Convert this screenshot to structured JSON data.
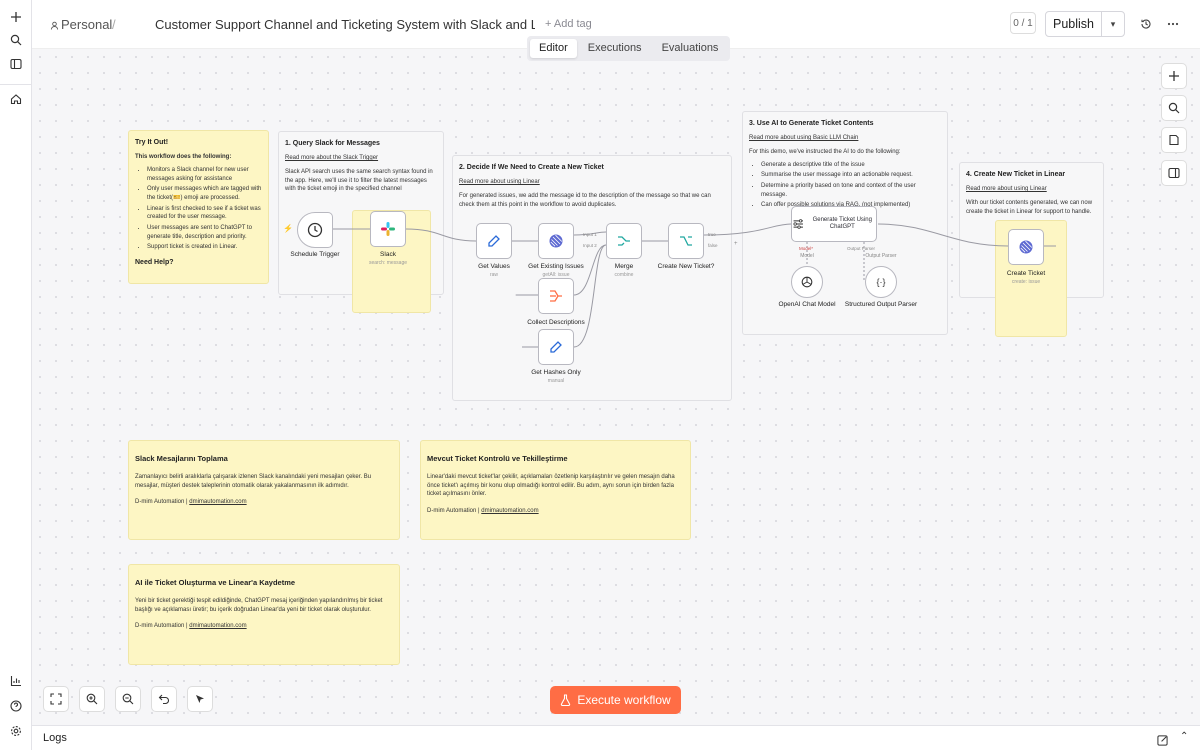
{
  "rail": {
    "icons": [
      "plus-icon",
      "search-icon",
      "sidebar-toggle-icon",
      "home-icon",
      "insights-icon",
      "help-icon",
      "settings-icon"
    ]
  },
  "header": {
    "project": "Personal",
    "separator": "/",
    "title": "Customer Support Channel and Ticketing System with Slack and Linear.js...",
    "add_tag": "+ Add tag",
    "versions": "0 / 1",
    "publish": "Publish"
  },
  "tabs": [
    {
      "label": "Editor",
      "active": true
    },
    {
      "label": "Executions",
      "active": false
    },
    {
      "label": "Evaluations",
      "active": false
    }
  ],
  "stickies": {
    "try": {
      "title": "Try It Out!",
      "intro": "This workflow does the following:",
      "bullets": [
        "Monitors a Slack channel for new user messages asking for assistance",
        "Only user messages which are tagged with the ticket(🎫) emoji are processed.",
        "Linear is first checked to see if a ticket was created for the user message.",
        "User messages are sent to ChatGPT to generate title, description and priority.",
        "Support ticket is created in Linear."
      ],
      "help": "Need Help?"
    },
    "s1": {
      "title": "1. Query Slack for Messages",
      "link": "Read more about the Slack Trigger",
      "body": "Slack API search uses the same search syntax found in the app. Here, we'll use it to filter the latest messages with the ticket emoji in the specified channel"
    },
    "s2": {
      "title": "2. Decide If We Need to Create a New Ticket",
      "link": "Read more about using Linear",
      "body": "For generated issues, we add the message id to the description of the message so that we can check them at this point in the workflow to avoid duplicates."
    },
    "s3": {
      "title": "3. Use AI to Generate Ticket Contents",
      "link": "Read more about using Basic LLM Chain",
      "body": "For this demo, we've instructed the AI to do the following:",
      "bullets": [
        "Generate a descriptive title of the issue",
        "Summarise the user message into an actionable request.",
        "Determine a priority based on tone and context of the user message.",
        "Can offer possible solutions via RAG. (not implemented)"
      ]
    },
    "s4": {
      "title": "4. Create New Ticket in Linear",
      "link": "Read more about using Linear",
      "body": "With our ticket contents generated, we can now create the ticket in Linear for support to handle."
    },
    "tr1": {
      "title": "Slack Mesajlarını Toplama",
      "body": "Zamanlayıcı belirli aralıklarla çalışarak izlenen Slack kanalındaki yeni mesajları çeker. Bu mesajlar, müşteri destek taleplerinin otomatik olarak yakalanmasının ilk adımıdır.",
      "sig": "D-mim Automation | ",
      "sig_link": "dmimautomation.com"
    },
    "tr2": {
      "title": "Mevcut Ticket Kontrolü ve Tekilleştirme",
      "body": "Linear'daki mevcut ticket'lar çekilir, açıklamaları özetlenip karşılaştırılır ve gelen mesajın daha önce ticket'ı açılmış bir konu olup olmadığı kontrol edilir. Bu adım, aynı sorun için birden fazla ticket açılmasını önler.",
      "sig": "D-mim Automation | ",
      "sig_link": "dmimautomation.com"
    },
    "tr3": {
      "title": "AI ile Ticket Oluşturma ve Linear'a Kaydetme",
      "body": "Yeni bir ticket gerektiği tespit edildiğinde, ChatGPT mesaj içeriğinden yapılandırılmış bir ticket başlığı ve açıklaması üretir; bu içerik doğrudan Linear'da yeni bir ticket olarak oluşturulur.",
      "sig": "D-mim Automation | ",
      "sig_link": "dmimautomation.com"
    }
  },
  "nodes": {
    "schedule": {
      "label": "Schedule Trigger"
    },
    "slack": {
      "label": "Slack",
      "sub": "search: message"
    },
    "getvalues": {
      "label": "Get Values",
      "sub": "raw"
    },
    "getissues": {
      "label": "Get Existing Issues",
      "sub": "getAll: issue"
    },
    "collect": {
      "label": "Collect Descriptions"
    },
    "hashes": {
      "label": "Get Hashes Only",
      "sub": "manual"
    },
    "merge": {
      "label": "Merge",
      "sub": "combine",
      "in1": "Input 1",
      "in2": "Input 2"
    },
    "create_if": {
      "label": "Create New Ticket?",
      "true": "true",
      "false": "false"
    },
    "genticket": {
      "label": "Generate Ticket Using ChatGPT",
      "model": "Model*",
      "parser": "Output Parser"
    },
    "openai": {
      "label": "OpenAI Chat Model",
      "port": "Model"
    },
    "structured": {
      "label": "Structured Output Parser",
      "port": "Output Parser"
    },
    "createticket": {
      "label": "Create Ticket",
      "sub": "create: issue"
    }
  },
  "canvas_controls": [
    "zoom-to-fit",
    "zoom-in",
    "zoom-out",
    "undo",
    "tidy-up"
  ],
  "right_controls": [
    "add-node",
    "search-nodes",
    "sticky-note",
    "toggle-panel"
  ],
  "execute": "Execute workflow",
  "logs": "Logs",
  "colors": {
    "accent": "#ff6d45",
    "sticky_yellow": "#fdf6c4",
    "linear": "#5e6ad2"
  }
}
